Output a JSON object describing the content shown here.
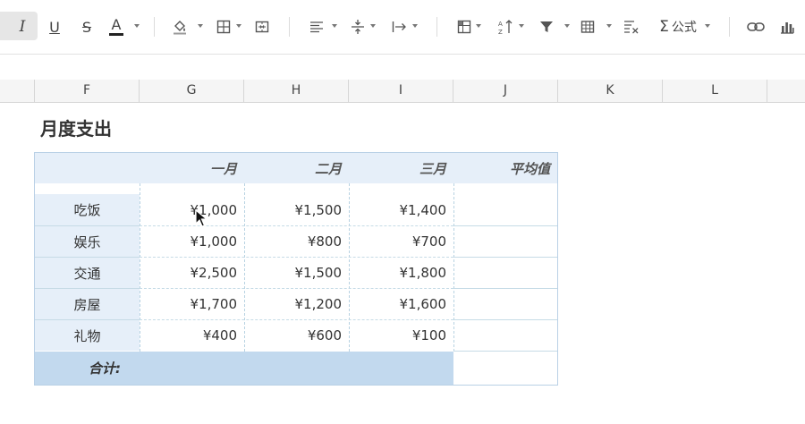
{
  "toolbar": {
    "italic_label": "I",
    "underline_label": "U",
    "strike_label": "S",
    "font_color_label": "A",
    "formula_label": "公式",
    "accent_color": "#1a73e8",
    "icons": [
      "italic-icon",
      "underline-icon",
      "strikethrough-icon",
      "font-color-icon",
      "fill-color-icon",
      "borders-icon",
      "merge-cells-icon",
      "align-left-icon",
      "vertical-align-icon",
      "text-wrap-icon",
      "freeze-icon",
      "sort-icon",
      "filter-icon",
      "table-icon",
      "clear-format-icon",
      "sum-icon",
      "link-icon",
      "chart-icon"
    ]
  },
  "columns": [
    "F",
    "G",
    "H",
    "I",
    "J",
    "K",
    "L"
  ],
  "sheet": {
    "title": "月度支出",
    "headers": [
      "一月",
      "二月",
      "三月",
      "平均值"
    ],
    "rows": [
      {
        "label": "吃饭",
        "values": [
          "¥1,000",
          "¥1,500",
          "¥1,400"
        ]
      },
      {
        "label": "娱乐",
        "values": [
          "¥1,000",
          "¥800",
          "¥700"
        ]
      },
      {
        "label": "交通",
        "values": [
          "¥2,500",
          "¥1,500",
          "¥1,800"
        ]
      },
      {
        "label": "房屋",
        "values": [
          "¥1,700",
          "¥1,200",
          "¥1,600"
        ]
      },
      {
        "label": "礼物",
        "values": [
          "¥400",
          "¥600",
          "¥100"
        ]
      }
    ],
    "total_label": "合计:",
    "header_bg": "#e6eff9",
    "total_bg": "#c2d9ee"
  }
}
